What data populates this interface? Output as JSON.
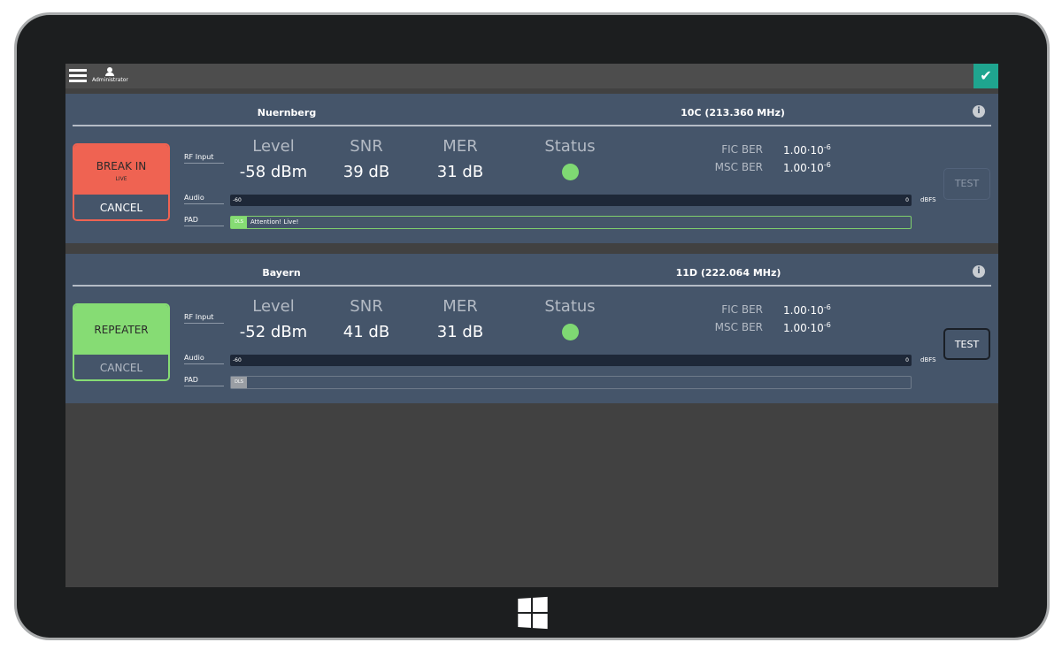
{
  "topbar": {
    "user": "Administrator",
    "confirm_icon": "check-icon"
  },
  "panels": [
    {
      "name": "Nuernberg",
      "frequency": "10C (213.360 MHz)",
      "action": "BREAK IN",
      "action_sub": "LIVE",
      "cancel": "CANCEL",
      "action_color": "#ef6352",
      "rf_label": "RF Input",
      "level_h": "Level",
      "level": "-58 dBm",
      "snr_h": "SNR",
      "snr": "39 dB",
      "mer_h": "MER",
      "mer": "31 dB",
      "status_h": "Status",
      "status_color": "#7fd873",
      "fic_l": "FIC BER",
      "fic": "1.00·10",
      "fic_exp": "-6",
      "msc_l": "MSC BER",
      "msc": "1.00·10",
      "msc_exp": "-6",
      "test": "TEST",
      "audio_l": "Audio",
      "audio_min": "-60",
      "audio_max": "0",
      "audio_unit": "dBFS",
      "pad_l": "PAD",
      "dls": "DLS",
      "pad_text": "Attention! Live!"
    },
    {
      "name": "Bayern",
      "frequency": "11D (222.064 MHz)",
      "action": "REPEATER",
      "cancel": "CANCEL",
      "action_color": "#86dc74",
      "rf_label": "RF Input",
      "level_h": "Level",
      "level": "-52 dBm",
      "snr_h": "SNR",
      "snr": "41 dB",
      "mer_h": "MER",
      "mer": "31 dB",
      "status_h": "Status",
      "status_color": "#7fd873",
      "fic_l": "FIC BER",
      "fic": "1.00·10",
      "fic_exp": "-6",
      "msc_l": "MSC BER",
      "msc": "1.00·10",
      "msc_exp": "-6",
      "test": "TEST",
      "audio_l": "Audio",
      "audio_min": "-60",
      "audio_max": "0",
      "audio_unit": "dBFS",
      "pad_l": "PAD",
      "dls": "DLS",
      "pad_text": ""
    }
  ]
}
